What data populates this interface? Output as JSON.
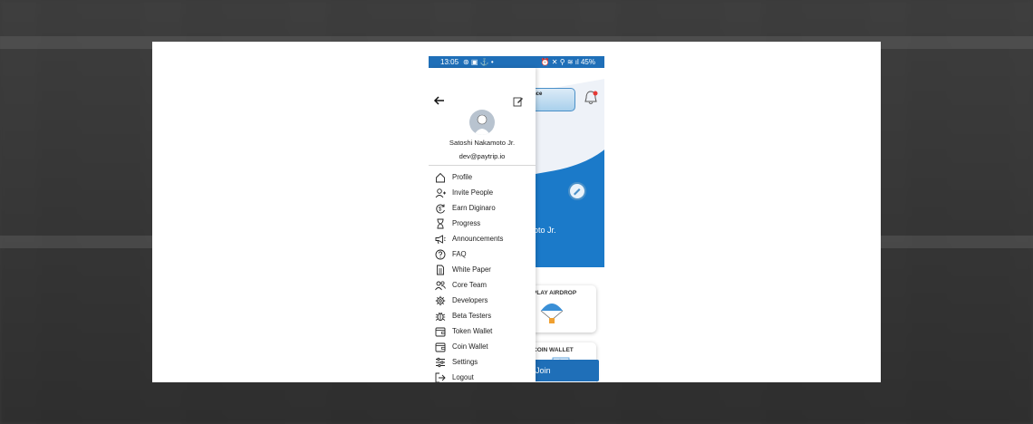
{
  "status_bar": {
    "time": "13:05",
    "left_icons": "⊛ ▣ ⚓ •",
    "right_icons": "⏰ ✕ ⚲ ≋ ıl",
    "battery": "45%"
  },
  "background_app": {
    "balance_fragment": "nce",
    "name_fragment": "oto Jr.",
    "cards": [
      {
        "label": "PLAY AIRDROP",
        "icon": "parachute-icon"
      },
      {
        "label": "COIN WALLET",
        "icon": "wallet-icon"
      }
    ],
    "join_label": "Join"
  },
  "drawer": {
    "user_name": "Satoshi Nakamoto Jr.",
    "user_email": "dev@paytrip.io",
    "menu": [
      {
        "label": "Profile",
        "icon": "home-icon"
      },
      {
        "label": "Invite People",
        "icon": "add-person-icon"
      },
      {
        "label": "Earn Diginaro",
        "icon": "coin-refresh-icon"
      },
      {
        "label": "Progress",
        "icon": "hourglass-icon"
      },
      {
        "label": "Announcements",
        "icon": "megaphone-icon"
      },
      {
        "label": "FAQ",
        "icon": "question-icon"
      },
      {
        "label": "White Paper",
        "icon": "document-icon"
      },
      {
        "label": "Core Team",
        "icon": "team-icon"
      },
      {
        "label": "Developers",
        "icon": "gear-icon"
      },
      {
        "label": "Beta Testers",
        "icon": "bug-icon"
      },
      {
        "label": "Token Wallet",
        "icon": "wallet-icon"
      },
      {
        "label": "Coin Wallet",
        "icon": "wallet-icon"
      },
      {
        "label": "Settings",
        "icon": "sliders-icon"
      },
      {
        "label": "Logout",
        "icon": "logout-icon"
      }
    ]
  },
  "colors": {
    "primary_blue": "#1f6fb8",
    "drawer_bg": "#ffffff",
    "text": "#222222"
  }
}
